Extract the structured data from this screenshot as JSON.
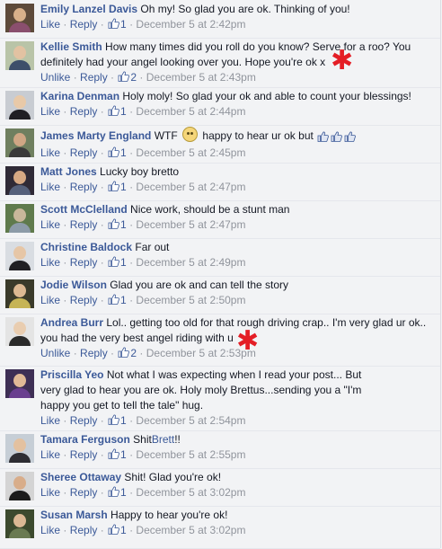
{
  "colors": {
    "link": "#3b5998",
    "meta": "#90949c",
    "annotation": "#e41e26",
    "background": "#f2f3f5"
  },
  "separator": "·",
  "annotation_glyph": "✱",
  "comments": [
    {
      "author": "Emily Lanzel Davis",
      "text": "Oh my! So glad you are ok. Thinking of you!",
      "like_label": "Like",
      "reply_label": "Reply",
      "likes": "1",
      "time": "December 5 at 2:42pm",
      "avatar_bg": "#5d4a3a",
      "skin": "#d8b08a",
      "shirt": "#8a4f6e"
    },
    {
      "author": "Kellie Smith",
      "text": "How many times did you roll do you know? Serve for a roo? You definitely had your angel looking over you. Hope you're ok x",
      "like_label": "Unlike",
      "reply_label": "Reply",
      "likes": "2",
      "time": "December 5 at 2:43pm",
      "avatar_bg": "#b9c4a8",
      "skin": "#e2c2a2",
      "shirt": "#3d4f6a",
      "annotated": true
    },
    {
      "author": "Karina Denman",
      "text": "Holy moly! So glad your ok and able to count your blessings!",
      "like_label": "Like",
      "reply_label": "Reply",
      "likes": "1",
      "time": "December 5 at 2:44pm",
      "avatar_bg": "#c8ccd2",
      "skin": "#e8c9a8",
      "shirt": "#1f1f24"
    },
    {
      "author": "James Marty England",
      "text_before": "WTF",
      "text_after": "happy to hear ur ok but",
      "like_label": "Like",
      "reply_label": "Reply",
      "likes": "1",
      "time": "December 5 at 2:45pm",
      "avatar_bg": "#6f7f5f",
      "skin": "#cfa684",
      "shirt": "#3a3a3a",
      "emoji": "embarrassed-emoji",
      "inline_thumbs": 3
    },
    {
      "author": "Matt Jones",
      "text": "Lucky boy bretto",
      "like_label": "Like",
      "reply_label": "Reply",
      "likes": "1",
      "time": "December 5 at 2:47pm",
      "avatar_bg": "#2f2a36",
      "skin": "#d6a883",
      "shirt": "#55607a"
    },
    {
      "author": "Scott McClelland",
      "text": "Nice work, should be a stunt man",
      "like_label": "Like",
      "reply_label": "Reply",
      "likes": "1",
      "time": "December 5 at 2:47pm",
      "avatar_bg": "#5f7a4c",
      "skin": "#c9b79a",
      "shirt": "#8c9ba8"
    },
    {
      "author": "Christine Baldock",
      "text": "Far out",
      "like_label": "Like",
      "reply_label": "Reply",
      "likes": "1",
      "time": "December 5 at 2:49pm",
      "avatar_bg": "#d9dde2",
      "skin": "#e6c6a6",
      "shirt": "#202024"
    },
    {
      "author": "Jodie Wilson",
      "text": "Glad you are ok and can tell the story",
      "like_label": "Like",
      "reply_label": "Reply",
      "likes": "1",
      "time": "December 5 at 2:50pm",
      "avatar_bg": "#3a3a2a",
      "skin": "#dcb892",
      "shirt": "#c6b456"
    },
    {
      "author": "Andrea Burr",
      "text": "Lol.. getting too old for that rough driving crap.. I'm very glad ur ok.. you had the very best angel riding with u",
      "like_label": "Unlike",
      "reply_label": "Reply",
      "likes": "2",
      "time": "December 5 at 2:53pm",
      "avatar_bg": "#e4e4e4",
      "skin": "#e9cdb0",
      "shirt": "#2a2a2a",
      "annotated": true
    },
    {
      "author": "Priscilla Yeo",
      "text": "Not what I was expecting when I read your post... But very glad to hear you are ok. Holy moly Brettus...sending you a \"I'm happy you get to tell the tale\" hug.",
      "like_label": "Like",
      "reply_label": "Reply",
      "likes": "1",
      "time": "December 5 at 2:54pm",
      "avatar_bg": "#3e2f55",
      "skin": "#e0b996",
      "shirt": "#6a3f8f"
    },
    {
      "author": "Tamara Ferguson",
      "text_before": "Shit",
      "inline_link": "Brett",
      "text_after": "!!",
      "like_label": "Like",
      "reply_label": "Reply",
      "likes": "1",
      "time": "December 5 at 2:55pm",
      "avatar_bg": "#c6ced6",
      "skin": "#e3c1a0",
      "shirt": "#2d2d33"
    },
    {
      "author": "Sheree Ottaway",
      "text": "Shit! Glad you're ok!",
      "like_label": "Like",
      "reply_label": "Reply",
      "likes": "1",
      "time": "December 5 at 3:02pm",
      "avatar_bg": "#d4d4d4",
      "skin": "#d8ad8a",
      "shirt": "#1c1c1c"
    },
    {
      "author": "Susan Marsh",
      "text": "Happy to hear you're ok!",
      "like_label": "Like",
      "reply_label": "Reply",
      "likes": "1",
      "time": "December 5 at 3:02pm",
      "avatar_bg": "#3c4a2e",
      "skin": "#dbb894",
      "shirt": "#6a7a52"
    }
  ]
}
